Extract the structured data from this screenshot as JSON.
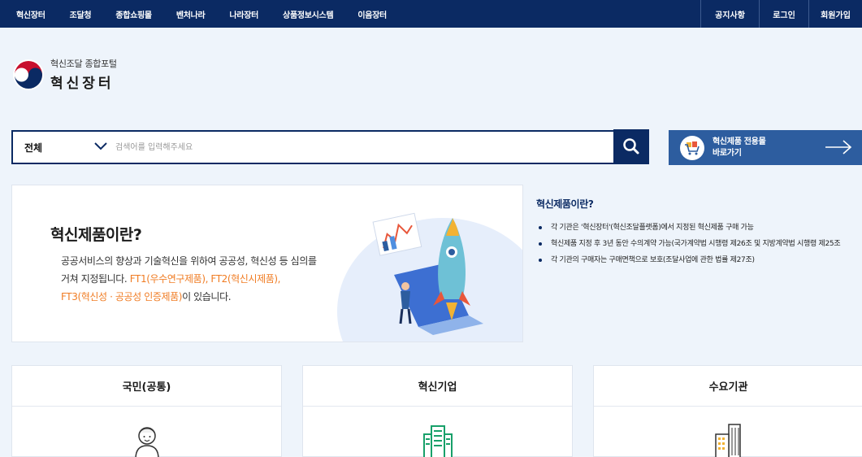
{
  "nav": {
    "left": [
      "혁신장터",
      "조달청",
      "종합쇼핑몰",
      "벤처나라",
      "나라장터",
      "상품정보시스템",
      "이음장터"
    ],
    "right": [
      "공지사항",
      "로그인",
      "회원가입"
    ]
  },
  "logo": {
    "subtitle": "혁신조달 종합포털",
    "title": "혁신장터"
  },
  "search": {
    "category": "전체",
    "placeholder": "검색어를 입력해주세요"
  },
  "shortcut": {
    "line1": "혁신제품 전용몰",
    "line2": "바로가기"
  },
  "intro": {
    "heading": "혁신제품이란?",
    "line1": "공공서비스의 향상과 기술혁신을 위하여 공공성, 혁신성 등 심의를",
    "line2a": "거쳐 지정됩니다. ",
    "line2b": "FT1(우수연구제품), FT2(혁신시제품),",
    "line3a": "FT3(혁신성 · 공공성 인증제품)",
    "line3b": "이 있습니다."
  },
  "info": {
    "heading": "혁신제품이란?",
    "items": [
      "각 기관은 '혁신장터'(혁신조달플랫폼)에서 지정된 혁신제품 구매 가능",
      "혁신제품 지정 후 3년 동안 수의계약 가능(국가계약법 시행령 제26조 및 지방계약법 시행령 제25조",
      "각 기관의 구매자는 구매면책으로 보호(조달사업에 관한 법률 제27조)"
    ]
  },
  "cards": [
    "국민(공통)",
    "혁신기업",
    "수요기관"
  ],
  "colors": {
    "navy": "#0b2a63",
    "accent_blue": "#2d5d9f",
    "highlight_orange": "#f07c23",
    "page_bg": "#eef4fb"
  }
}
